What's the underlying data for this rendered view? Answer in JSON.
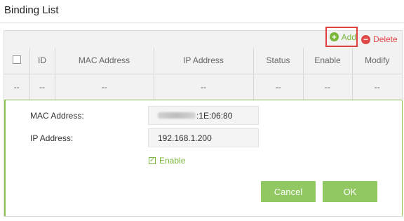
{
  "header": {
    "title": "Binding List"
  },
  "toolbar": {
    "add_label": "Add",
    "delete_label": "Delete"
  },
  "table": {
    "columns": [
      "ID",
      "MAC Address",
      "IP Address",
      "Status",
      "Enable",
      "Modify"
    ],
    "rows": [
      {
        "checkbox": "--",
        "id": "--",
        "mac": "--",
        "ip": "--",
        "status": "--",
        "enable": "--",
        "modify": "--"
      }
    ]
  },
  "form": {
    "mac_label": "MAC Address:",
    "mac_value_visible": ":1E:06:80",
    "ip_label": "IP Address:",
    "ip_value": "192.168.1.200",
    "enable_label": "Enable",
    "enable_checked": true,
    "cancel_label": "Cancel",
    "ok_label": "OK"
  },
  "colors": {
    "accent_green": "#7ab73b",
    "button_green": "#91c861",
    "delete_red": "#e04848",
    "highlight_red": "#e04040"
  },
  "icons": {
    "add": "plus-circle-icon",
    "delete": "minus-circle-icon",
    "enable": "checkbox-checked-icon"
  }
}
